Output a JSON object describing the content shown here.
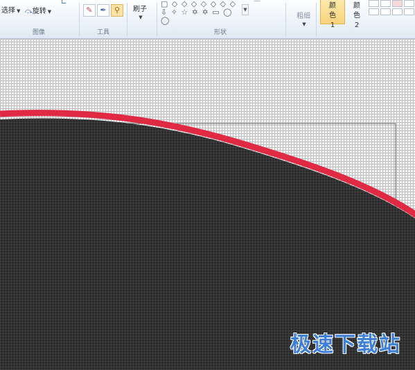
{
  "ribbon": {
    "image_group": {
      "label": "图像",
      "select_label": "选择",
      "rotate_label": "旋转"
    },
    "tools_group": {
      "label": "工具"
    },
    "brushes_label": "刷子",
    "shapes_group": {
      "label": "形状"
    },
    "outline_label": "粗细",
    "color1_label": "颜色 1",
    "color2_label": "颜色 2",
    "palette_colors": [
      "#ffffff",
      "#ffffff",
      "#f7d9d9",
      "#ffffff",
      "#ffffff",
      "#ffffff",
      "#ffffff",
      "#ffffff"
    ]
  },
  "canvas": {
    "shape_fill": "#2a2a2a",
    "outline_color": "#e02a44",
    "grid_color": "#bdbdbd"
  },
  "watermark": "极速下载站"
}
